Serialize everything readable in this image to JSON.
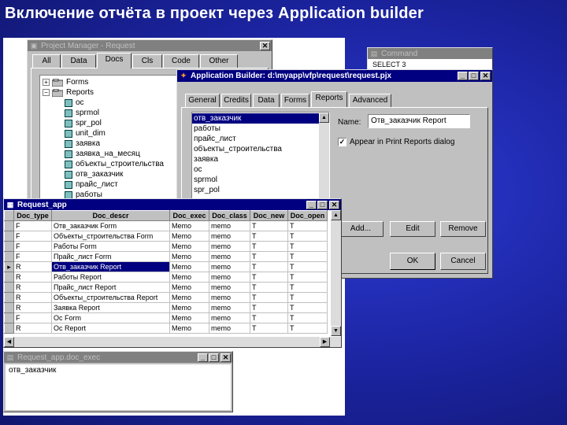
{
  "slide": {
    "title": "Включение отчёта в проект через Application builder"
  },
  "project_manager": {
    "title": "Project Manager - Request",
    "tabs": [
      "All",
      "Data",
      "Docs",
      "Cls",
      "Code",
      "Other"
    ],
    "selected_tab": "Docs",
    "tree": [
      {
        "label": "Forms",
        "level": 0,
        "type": "folder",
        "expander": "+"
      },
      {
        "label": "Reports",
        "level": 0,
        "type": "folder",
        "expander": "−"
      },
      {
        "label": "oc",
        "level": 1,
        "type": "doc"
      },
      {
        "label": "sprmol",
        "level": 1,
        "type": "doc"
      },
      {
        "label": "spr_pol",
        "level": 1,
        "type": "doc"
      },
      {
        "label": "unit_dim",
        "level": 1,
        "type": "doc"
      },
      {
        "label": "заявка",
        "level": 1,
        "type": "doc"
      },
      {
        "label": "заявка_на_месяц",
        "level": 1,
        "type": "doc"
      },
      {
        "label": "объекты_строительства",
        "level": 1,
        "type": "doc"
      },
      {
        "label": "отв_заказчик",
        "level": 1,
        "type": "doc"
      },
      {
        "label": "прайс_лист",
        "level": 1,
        "type": "doc"
      },
      {
        "label": "работы",
        "level": 1,
        "type": "doc"
      }
    ]
  },
  "command_window": {
    "title": "Command",
    "text": "SELECT 3"
  },
  "app_builder": {
    "title": "Application Builder: d:\\myapp\\vfp\\request\\request.pjx",
    "tabs": [
      "General",
      "Credits",
      "Data",
      "Forms",
      "Reports",
      "Advanced"
    ],
    "selected_tab": "Reports",
    "report_list": [
      "отв_заказчик",
      "работы",
      "прайс_лист",
      "объекты_строительства",
      "заявка",
      "ос",
      "sprmol",
      "spr_pol"
    ],
    "selected_report": "отв_заказчик",
    "name_label": "Name:",
    "name_value": "Отв_заказчик Report",
    "checkbox_label": "Appear in Print Reports dialog",
    "checkbox_checked": true,
    "buttons": {
      "add": "Add...",
      "edit": "Edit",
      "remove": "Remove",
      "ok": "OK",
      "cancel": "Cancel"
    }
  },
  "browse_window": {
    "title": "Request_app",
    "columns": [
      "Doc_type",
      "Doc_descr",
      "Doc_exec",
      "Doc_class",
      "Doc_new",
      "Doc_open"
    ],
    "rows": [
      [
        "F",
        "Отв_заказчик Form",
        "Memo",
        "memo",
        "T",
        "T"
      ],
      [
        "F",
        "Объекты_строительства Form",
        "Memo",
        "memo",
        "T",
        "T"
      ],
      [
        "F",
        "Работы Form",
        "Memo",
        "memo",
        "T",
        "T"
      ],
      [
        "F",
        "Прайс_лист Form",
        "Memo",
        "memo",
        "T",
        "T"
      ],
      [
        "R",
        "Отв_заказчик Report",
        "Memo",
        "memo",
        "T",
        "T"
      ],
      [
        "R",
        "Работы Report",
        "Memo",
        "memo",
        "T",
        "T"
      ],
      [
        "R",
        "Прайс_лист Report",
        "Memo",
        "memo",
        "T",
        "T"
      ],
      [
        "R",
        "Объекты_строительства Report",
        "Memo",
        "memo",
        "T",
        "T"
      ],
      [
        "R",
        "Заявка Report",
        "Memo",
        "memo",
        "T",
        "T"
      ],
      [
        "F",
        "Ос Form",
        "Memo",
        "memo",
        "T",
        "T"
      ],
      [
        "R",
        "Ос Report",
        "Memo",
        "memo",
        "T",
        "T"
      ]
    ],
    "current_row": 4,
    "current_marker": "▸"
  },
  "memo_window": {
    "title": "Request_app.doc_exec",
    "text": "отв_заказчик"
  },
  "colors": {
    "active_title": "#000080",
    "inactive_title": "#808080",
    "window_face": "#c0c0c0",
    "background": "#1b239e"
  }
}
